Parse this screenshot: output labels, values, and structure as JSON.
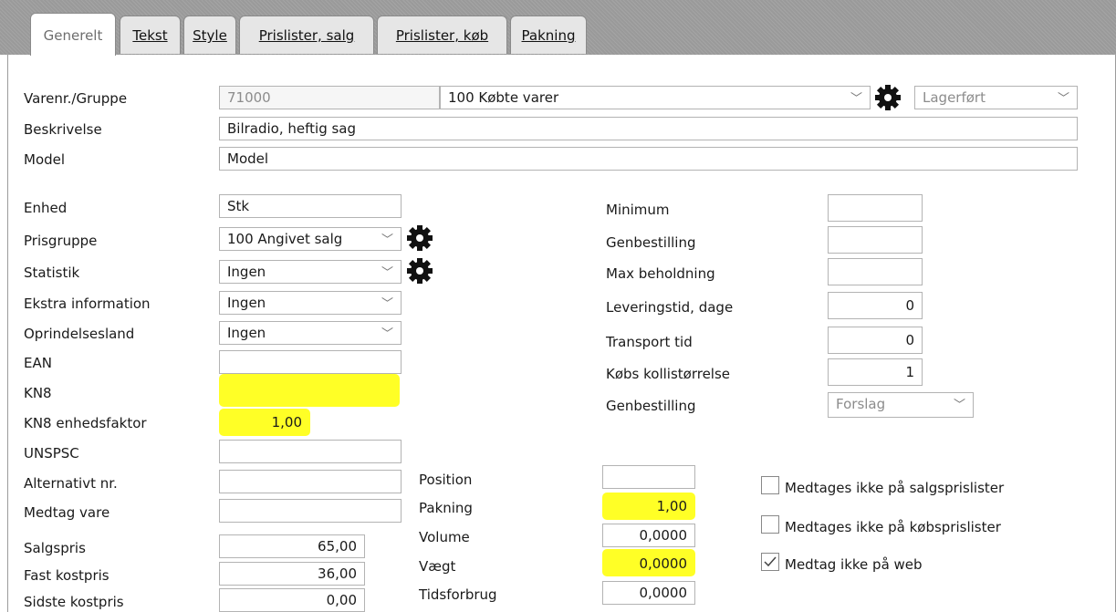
{
  "tabs": [
    "Generelt",
    "Tekst",
    "Style",
    "Prislister, salg",
    "Prislister, køb",
    "Pakning"
  ],
  "header": {
    "varenr_label": "Varenr./Gruppe",
    "varenr_value": "71000",
    "gruppe_value": "100 Købte varer",
    "lager_value": "Lagerført",
    "beskrivelse_label": "Beskrivelse",
    "beskrivelse_value": "Bilradio, heftig sag",
    "model_label": "Model",
    "model_value": "Model"
  },
  "left": {
    "enhed_label": "Enhed",
    "enhed_value": "Stk",
    "prisgruppe_label": "Prisgruppe",
    "prisgruppe_value": "100 Angivet salg",
    "statistik_label": "Statistik",
    "statistik_value": "Ingen",
    "ekstra_label": "Ekstra information",
    "ekstra_value": "Ingen",
    "oprindelse_label": "Oprindelsesland",
    "oprindelse_value": "Ingen",
    "ean_label": "EAN",
    "ean_value": "",
    "kn8_label": "KN8",
    "kn8_value": "",
    "kn8f_label": "KN8 enhedsfaktor",
    "kn8f_value": "1,00",
    "unspsc_label": "UNSPSC",
    "unspsc_value": "",
    "altnr_label": "Alternativt nr.",
    "altnr_value": "",
    "medtag_label": "Medtag vare",
    "medtag_value": "",
    "salgspris_label": "Salgspris",
    "salgspris_value": "65,00",
    "fastkost_label": "Fast kostpris",
    "fastkost_value": "36,00",
    "sidstekost_label": "Sidste kostpris",
    "sidstekost_value": "0,00"
  },
  "right": {
    "minimum_label": "Minimum",
    "minimum_value": "",
    "genbestilling_label": "Genbestilling",
    "genbestilling_value": "",
    "max_label": "Max beholdning",
    "max_value": "",
    "leveringstid_label": "Leveringstid, dage",
    "leveringstid_value": "0",
    "transport_label": "Transport tid",
    "transport_value": "0",
    "kolli_label": "Købs kollistørrelse",
    "kolli_value": "1",
    "genbestilling2_label": "Genbestilling",
    "genbestilling2_value": "Forslag"
  },
  "middle": {
    "position_label": "Position",
    "position_value": "",
    "pakning_label": "Pakning",
    "pakning_value": "1,00",
    "volume_label": "Volume",
    "volume_value": "0,0000",
    "vaegt_label": "Vægt",
    "vaegt_value": "0,0000",
    "tidsforbrug_label": "Tidsforbrug",
    "tidsforbrug_value": "0,0000"
  },
  "checkboxes": [
    {
      "label": "Medtages ikke på salgsprislister",
      "checked": false
    },
    {
      "label": "Medtages ikke på købsprislister",
      "checked": false
    },
    {
      "label": "Medtag ikke på web",
      "checked": true
    }
  ],
  "colors": {
    "highlight": "#ffff00",
    "tabbar": "#9a9a9a"
  }
}
